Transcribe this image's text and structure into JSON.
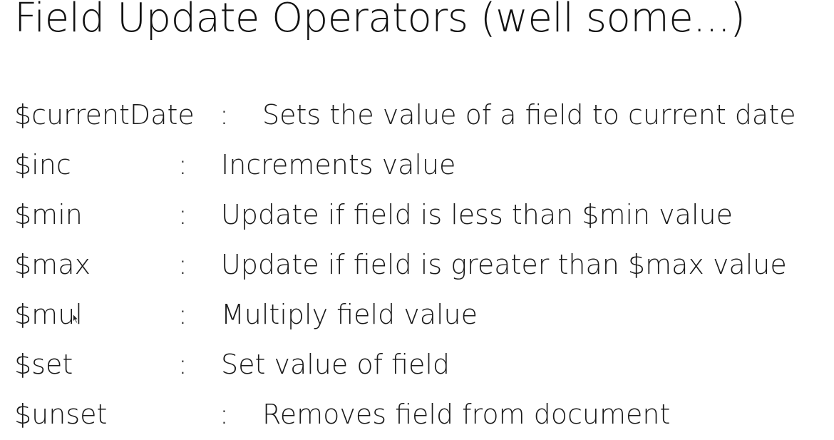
{
  "slide": {
    "title": "Field Update Operators (well some...)"
  },
  "operators": [
    {
      "name": "$currentDate",
      "separator": ":",
      "description": "Sets the value of a field to current date"
    },
    {
      "name": "$inc",
      "separator": ":",
      "description": "Increments value"
    },
    {
      "name": "$min",
      "separator": ":",
      "description": "Update if field is less than $min value"
    },
    {
      "name": "$max",
      "separator": ":",
      "description": "Update if field is greater than $max value"
    },
    {
      "name": "$mul",
      "separator": ":",
      "description": "Multiply field value"
    },
    {
      "name": "$set",
      "separator": ":",
      "description": "Set value of field"
    },
    {
      "name": "$unset",
      "separator": ":",
      "description": "Removes field from document"
    }
  ]
}
